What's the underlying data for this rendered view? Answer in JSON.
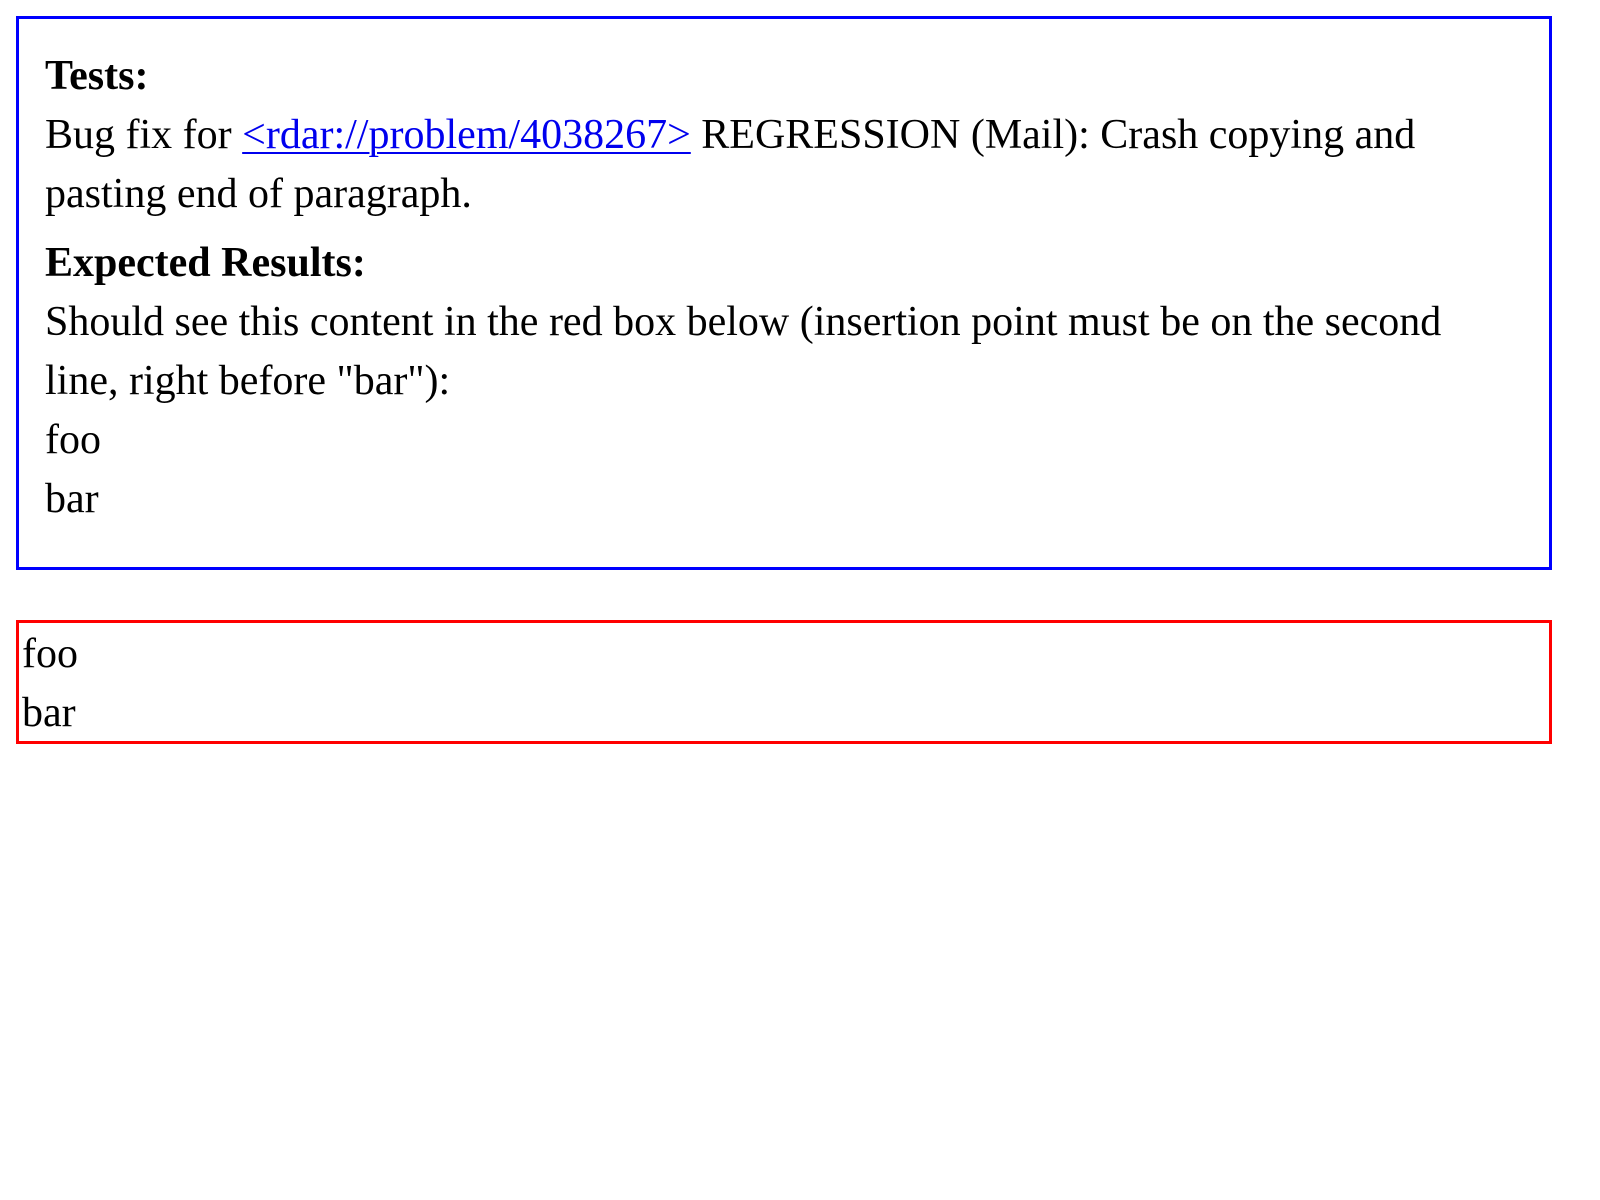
{
  "explanation": {
    "tests_heading": "Tests:",
    "tests_prefix": "Bug fix for ",
    "bug_link_text": "<rdar://problem/4038267>",
    "tests_suffix": " REGRESSION (Mail): Crash copying and pasting end of paragraph.",
    "expected_heading": "Expected Results:",
    "expected_text": "Should see this content in the red box below (insertion point must be on the second line, right before \"bar\"):",
    "expected_lines": [
      "foo",
      "bar"
    ]
  },
  "test_box": {
    "lines": [
      "foo",
      "bar"
    ]
  },
  "colors": {
    "explanation_border": "#0000ff",
    "test_box_border": "#ff0000",
    "link": "#0000ee"
  }
}
